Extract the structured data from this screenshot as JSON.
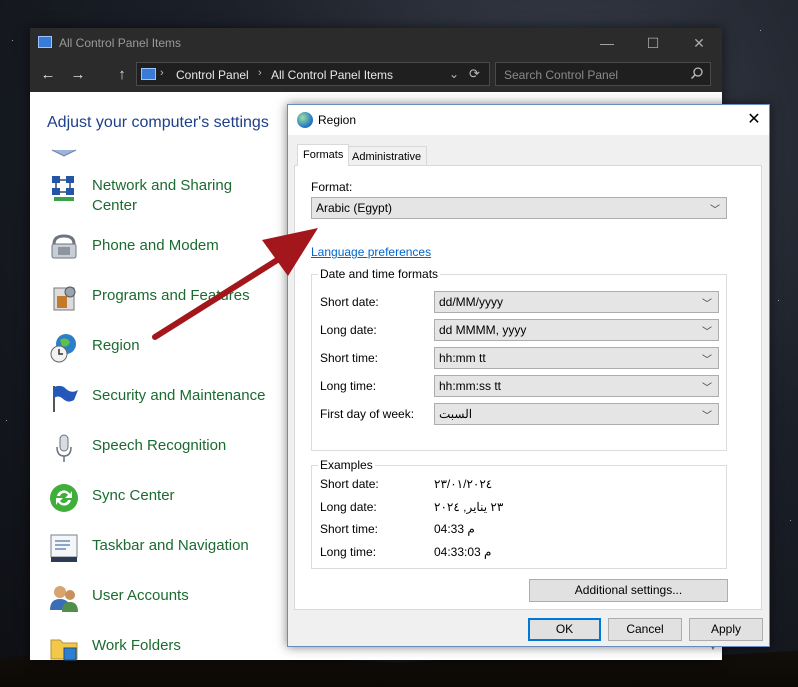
{
  "control_panel": {
    "title": "All Control Panel Items",
    "window_controls": {
      "minimize": "—",
      "maximize": "☐",
      "close": "✕"
    },
    "nav": {
      "back": "←",
      "forward": "→",
      "up": "↑",
      "dropdown": "⌄",
      "refresh": "⟳"
    },
    "breadcrumb": [
      "Control Panel",
      "All Control Panel Items"
    ],
    "breadcrumb_separator": "›",
    "search_placeholder": "Search Control Panel",
    "heading": "Adjust your computer's settings",
    "items": [
      {
        "label": "Network and Sharing\nCenter",
        "icon": "network-icon"
      },
      {
        "label": "Phone and Modem",
        "icon": "phone-icon"
      },
      {
        "label": "Programs and Features",
        "icon": "programs-icon"
      },
      {
        "label": "Region",
        "icon": "globe-clock-icon"
      },
      {
        "label": "Security and Maintenance",
        "icon": "flag-icon"
      },
      {
        "label": "Speech Recognition",
        "icon": "microphone-icon"
      },
      {
        "label": "Sync Center",
        "icon": "sync-icon"
      },
      {
        "label": "Taskbar and Navigation",
        "icon": "taskbar-icon"
      },
      {
        "label": "User Accounts",
        "icon": "users-icon"
      },
      {
        "label": "Work Folders",
        "icon": "folder-icon"
      }
    ]
  },
  "dialog": {
    "title": "Region",
    "close_glyph": "✕",
    "tabs": [
      "Formats",
      "Administrative"
    ],
    "active_tab": "Formats",
    "format_label": "Format:",
    "format_value": "Arabic (Egypt)",
    "language_link": "Language preferences",
    "datetime_group": "Date and time formats",
    "datetime_rows": [
      {
        "label": "Short date:",
        "value": "dd/MM/yyyy"
      },
      {
        "label": "Long date:",
        "value": "dd MMMM, yyyy"
      },
      {
        "label": "Short time:",
        "value": "hh:mm tt"
      },
      {
        "label": "Long time:",
        "value": "hh:mm:ss tt"
      },
      {
        "label": "First day of week:",
        "value": "السبت"
      }
    ],
    "examples_group": "Examples",
    "examples": [
      {
        "label": "Short date:",
        "value": "٢٣/٠١/٢٠٢٤"
      },
      {
        "label": "Long date:",
        "value": "٢٣ يناير, ٢٠٢٤"
      },
      {
        "label": "Short time:",
        "value": "04:33 م"
      },
      {
        "label": "Long time:",
        "value": "04:33:03 م"
      }
    ],
    "additional_settings": "Additional settings...",
    "buttons": {
      "ok": "OK",
      "cancel": "Cancel",
      "apply": "Apply"
    }
  },
  "annotation": {
    "arrow_color": "#a3161c"
  },
  "colors": {
    "link": "#0066cc",
    "cp_item_text": "#1b6b30",
    "heading": "#1e3f8a"
  }
}
